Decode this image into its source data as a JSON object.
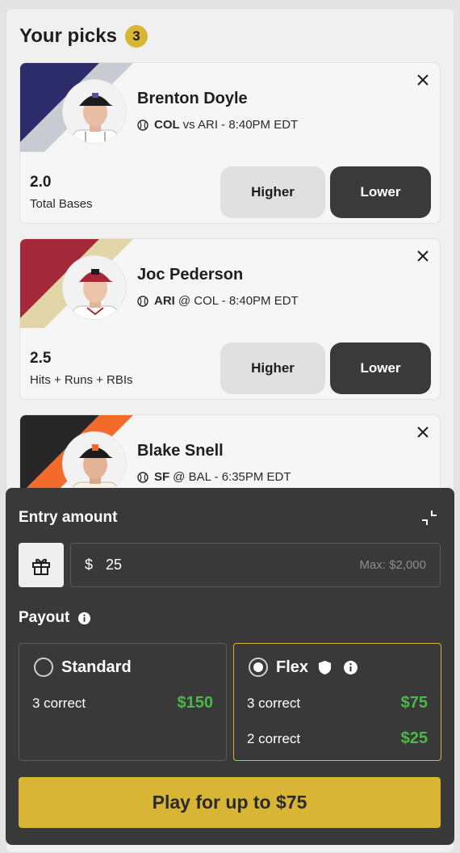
{
  "header": {
    "title": "Your picks",
    "count": "3"
  },
  "picks": [
    {
      "name": "Brenton Doyle",
      "team": "COL",
      "matchup_rest": "vs ARI - 8:40PM EDT",
      "stat_value": "2.0",
      "stat_label": "Total Bases",
      "higher_label": "Higher",
      "lower_label": "Lower",
      "colors": {
        "stripe_main": "#2d2c6b",
        "stripe_accent": "#c9cbd3",
        "cap": "#1c1c1c",
        "jersey": "#ffffff"
      }
    },
    {
      "name": "Joc Pederson",
      "team": "ARI",
      "matchup_rest": "@ COL - 8:40PM EDT",
      "stat_value": "2.5",
      "stat_label": "Hits + Runs + RBIs",
      "higher_label": "Higher",
      "lower_label": "Lower",
      "colors": {
        "stripe_main": "#a3283a",
        "stripe_accent": "#e2d6a9",
        "cap": "#a3283a",
        "jersey": "#ffffff"
      }
    },
    {
      "name": "Blake Snell",
      "team": "SF",
      "matchup_rest": "@ BAL - 6:35PM EDT",
      "colors": {
        "stripe_main": "#262626",
        "stripe_accent": "#f26b2b",
        "cap": "#1c1c1c",
        "jersey": "#ffffff"
      }
    }
  ],
  "entry": {
    "label": "Entry amount",
    "currency": "$",
    "value": "25",
    "max_label": "Max: $2,000"
  },
  "payout": {
    "label": "Payout",
    "standard": {
      "title": "Standard",
      "rows": [
        {
          "label": "3 correct",
          "amount": "$150"
        }
      ]
    },
    "flex": {
      "title": "Flex",
      "rows": [
        {
          "label": "3 correct",
          "amount": "$75"
        },
        {
          "label": "2 correct",
          "amount": "$25"
        }
      ]
    }
  },
  "play_button": "Play for up to $75",
  "colors": {
    "accent": "#d9b536",
    "green": "#4cb848",
    "drawer": "#393939"
  }
}
